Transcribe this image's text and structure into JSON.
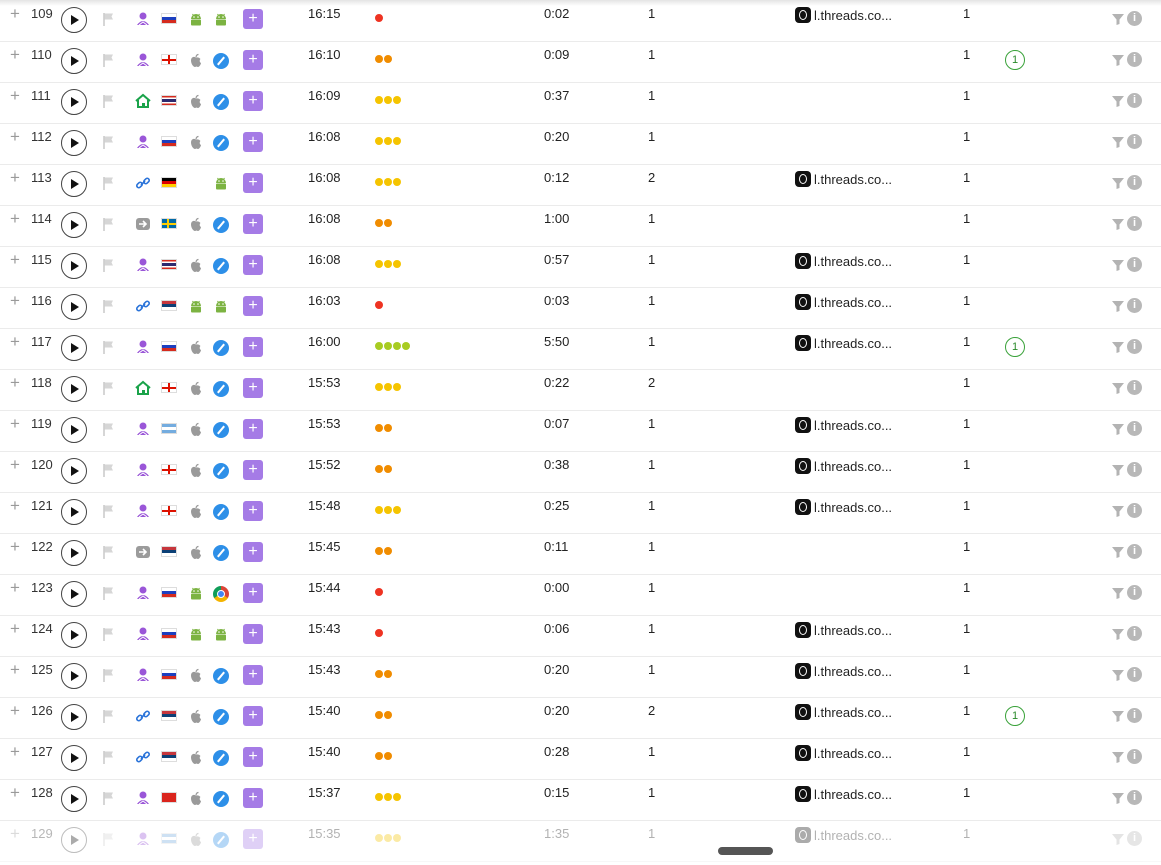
{
  "rows": [
    {
      "id": "109",
      "source": "person",
      "country": "ru",
      "os": "android",
      "browser": "android",
      "time": "16:15",
      "dots": 1,
      "dot_color": "#ee3322",
      "duration": "0:02",
      "pages": "1",
      "referrer": "l.threads.co...",
      "visits": "1",
      "badge": ""
    },
    {
      "id": "110",
      "source": "person",
      "country": "ge",
      "os": "apple",
      "browser": "safari",
      "time": "16:10",
      "dots": 2,
      "dot_color": "#f08c00",
      "duration": "0:09",
      "pages": "1",
      "referrer": "",
      "visits": "1",
      "badge": "1"
    },
    {
      "id": "111",
      "source": "home",
      "country": "th",
      "os": "apple",
      "browser": "safari",
      "time": "16:09",
      "dots": 3,
      "dot_color": "#f5c400",
      "duration": "0:37",
      "pages": "1",
      "referrer": "",
      "visits": "1",
      "badge": ""
    },
    {
      "id": "112",
      "source": "person",
      "country": "ru",
      "os": "apple",
      "browser": "safari",
      "time": "16:08",
      "dots": 3,
      "dot_color": "#f5c400",
      "duration": "0:20",
      "pages": "1",
      "referrer": "",
      "visits": "1",
      "badge": ""
    },
    {
      "id": "113",
      "source": "link",
      "country": "de",
      "os": "",
      "browser": "android",
      "time": "16:08",
      "dots": 3,
      "dot_color": "#f5c400",
      "duration": "0:12",
      "pages": "2",
      "referrer": "l.threads.co...",
      "visits": "1",
      "badge": ""
    },
    {
      "id": "114",
      "source": "arrow",
      "country": "se",
      "os": "apple",
      "browser": "safari",
      "time": "16:08",
      "dots": 2,
      "dot_color": "#f08c00",
      "duration": "1:00",
      "pages": "1",
      "referrer": "",
      "visits": "1",
      "badge": ""
    },
    {
      "id": "115",
      "source": "person",
      "country": "th",
      "os": "apple",
      "browser": "safari",
      "time": "16:08",
      "dots": 3,
      "dot_color": "#f5c400",
      "duration": "0:57",
      "pages": "1",
      "referrer": "l.threads.co...",
      "visits": "1",
      "badge": ""
    },
    {
      "id": "116",
      "source": "link",
      "country": "rs",
      "os": "android",
      "browser": "android",
      "time": "16:03",
      "dots": 1,
      "dot_color": "#ee3322",
      "duration": "0:03",
      "pages": "1",
      "referrer": "l.threads.co...",
      "visits": "1",
      "badge": ""
    },
    {
      "id": "117",
      "source": "person",
      "country": "ru",
      "os": "apple",
      "browser": "safari",
      "time": "16:00",
      "dots": 4,
      "dot_color": "#a8cc22",
      "duration": "5:50",
      "pages": "1",
      "referrer": "l.threads.co...",
      "visits": "1",
      "badge": "1"
    },
    {
      "id": "118",
      "source": "home",
      "country": "ge",
      "os": "apple",
      "browser": "safari",
      "time": "15:53",
      "dots": 3,
      "dot_color": "#f5c400",
      "duration": "0:22",
      "pages": "2",
      "referrer": "",
      "visits": "1",
      "badge": ""
    },
    {
      "id": "119",
      "source": "person",
      "country": "ar",
      "os": "apple",
      "browser": "safari",
      "time": "15:53",
      "dots": 2,
      "dot_color": "#f08c00",
      "duration": "0:07",
      "pages": "1",
      "referrer": "l.threads.co...",
      "visits": "1",
      "badge": ""
    },
    {
      "id": "120",
      "source": "person",
      "country": "ge",
      "os": "apple",
      "browser": "safari",
      "time": "15:52",
      "dots": 2,
      "dot_color": "#f08c00",
      "duration": "0:38",
      "pages": "1",
      "referrer": "l.threads.co...",
      "visits": "1",
      "badge": ""
    },
    {
      "id": "121",
      "source": "person",
      "country": "ge",
      "os": "apple",
      "browser": "safari",
      "time": "15:48",
      "dots": 3,
      "dot_color": "#f5c400",
      "duration": "0:25",
      "pages": "1",
      "referrer": "l.threads.co...",
      "visits": "1",
      "badge": ""
    },
    {
      "id": "122",
      "source": "arrow",
      "country": "rs",
      "os": "apple",
      "browser": "safari",
      "time": "15:45",
      "dots": 2,
      "dot_color": "#f08c00",
      "duration": "0:11",
      "pages": "1",
      "referrer": "",
      "visits": "1",
      "badge": ""
    },
    {
      "id": "123",
      "source": "person",
      "country": "ru",
      "os": "android",
      "browser": "chrome",
      "time": "15:44",
      "dots": 1,
      "dot_color": "#ee3322",
      "duration": "0:00",
      "pages": "1",
      "referrer": "",
      "visits": "1",
      "badge": ""
    },
    {
      "id": "124",
      "source": "person",
      "country": "ru",
      "os": "android",
      "browser": "android",
      "time": "15:43",
      "dots": 1,
      "dot_color": "#ee3322",
      "duration": "0:06",
      "pages": "1",
      "referrer": "l.threads.co...",
      "visits": "1",
      "badge": ""
    },
    {
      "id": "125",
      "source": "person",
      "country": "ru",
      "os": "apple",
      "browser": "safari",
      "time": "15:43",
      "dots": 2,
      "dot_color": "#f08c00",
      "duration": "0:20",
      "pages": "1",
      "referrer": "l.threads.co...",
      "visits": "1",
      "badge": ""
    },
    {
      "id": "126",
      "source": "link",
      "country": "rs",
      "os": "apple",
      "browser": "safari",
      "time": "15:40",
      "dots": 2,
      "dot_color": "#f08c00",
      "duration": "0:20",
      "pages": "2",
      "referrer": "l.threads.co...",
      "visits": "1",
      "badge": "1"
    },
    {
      "id": "127",
      "source": "link",
      "country": "rs",
      "os": "apple",
      "browser": "safari",
      "time": "15:40",
      "dots": 2,
      "dot_color": "#f08c00",
      "duration": "0:28",
      "pages": "1",
      "referrer": "l.threads.co...",
      "visits": "1",
      "badge": ""
    },
    {
      "id": "128",
      "source": "person",
      "country": "vn",
      "os": "apple",
      "browser": "safari",
      "time": "15:37",
      "dots": 3,
      "dot_color": "#f5c400",
      "duration": "0:15",
      "pages": "1",
      "referrer": "l.threads.co...",
      "visits": "1",
      "badge": ""
    },
    {
      "id": "129",
      "source": "person",
      "country": "ar",
      "os": "apple",
      "browser": "safari",
      "time": "15:35",
      "dots": 3,
      "dot_color": "#f5c400",
      "duration": "1:35",
      "pages": "1",
      "referrer": "l.threads.co...",
      "visits": "1",
      "badge": ""
    }
  ],
  "add_symbol": "+",
  "info_symbol": "i"
}
